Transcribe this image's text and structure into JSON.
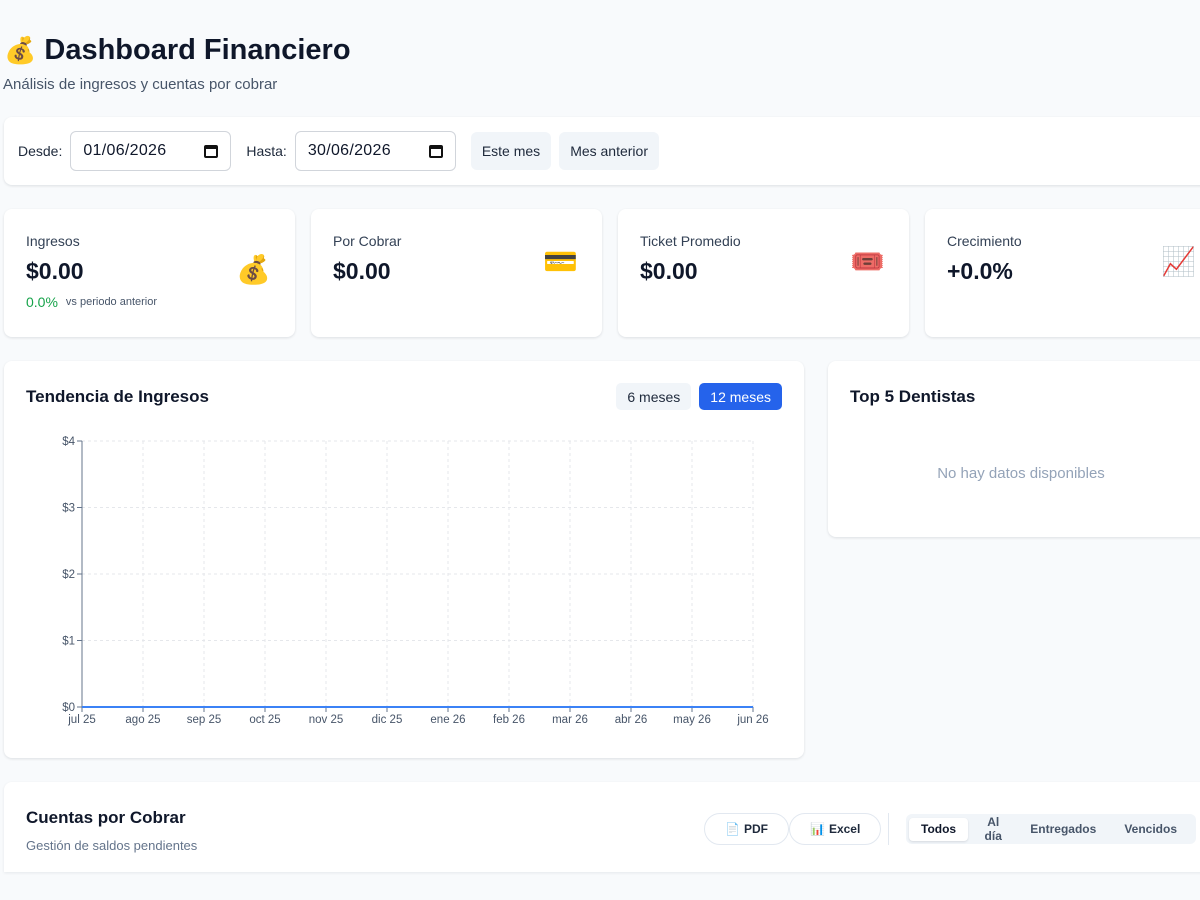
{
  "header": {
    "title": "Dashboard Financiero",
    "subtitle": "Análisis de ingresos y cuentas por cobrar"
  },
  "filters": {
    "from_label": "Desde:",
    "from_value": "01/06/2026",
    "to_label": "Hasta:",
    "to_value": "30/06/2026",
    "this_month": "Este mes",
    "last_month": "Mes anterior"
  },
  "kpis": [
    {
      "label": "Ingresos",
      "value": "$0.00",
      "icon": "money-bag-icon",
      "glyph": "💰",
      "change": "0.0%",
      "change_note": "vs periodo anterior"
    },
    {
      "label": "Por Cobrar",
      "value": "$0.00",
      "icon": "credit-card-icon",
      "glyph": "💳"
    },
    {
      "label": "Ticket Promedio",
      "value": "$0.00",
      "icon": "ticket-icon",
      "glyph": "🎟️"
    },
    {
      "label": "Crecimiento",
      "value": "+0.0%",
      "icon": "chart-increasing-icon",
      "glyph": "📈"
    }
  ],
  "trend": {
    "title": "Tendencia de Ingresos",
    "range_6": "6 meses",
    "range_12": "12 meses",
    "active_range": "12 meses"
  },
  "chart_data": {
    "type": "line",
    "categories": [
      "jul 25",
      "ago 25",
      "sep 25",
      "oct 25",
      "nov 25",
      "dic 25",
      "ene 26",
      "feb 26",
      "mar 26",
      "abr 26",
      "may 26",
      "jun 26"
    ],
    "series": [
      {
        "values": [
          0,
          0,
          0,
          0,
          0,
          0,
          0,
          0,
          0,
          0,
          0,
          0
        ],
        "color": "#3b82f6"
      }
    ],
    "yticks": [
      "$0",
      "$1",
      "$2",
      "$3",
      "$4"
    ],
    "ylim": [
      0,
      4
    ],
    "grid": true
  },
  "top_dentists": {
    "title": "Top 5 Dentistas",
    "empty": "No hay datos disponibles"
  },
  "accounts": {
    "title": "Cuentas por Cobrar",
    "subtitle": "Gestión de saldos pendientes",
    "pdf": "PDF",
    "excel": "Excel",
    "tabs": [
      "Todos",
      "Al día",
      "Entregados",
      "Vencidos"
    ],
    "selected_tab": "Todos"
  },
  "colors": {
    "accent": "#2563eb",
    "positive": "#16a34a",
    "line": "#3b82f6"
  }
}
